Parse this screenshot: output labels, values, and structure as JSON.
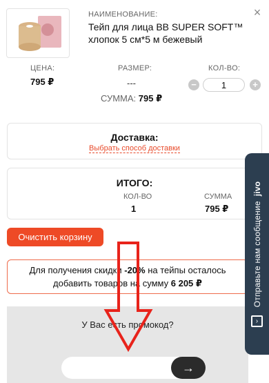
{
  "product": {
    "name_caption": "НАИМЕНОВАНИЕ:",
    "name": "Тейп для лица BB SUPER SOFT™ хлопок 5 см*5 м бежевый",
    "close_icon": "close-icon"
  },
  "columns": {
    "price_caption": "ЦЕНА:",
    "price_value": "795 ₽",
    "size_caption": "РАЗМЕР:",
    "size_value": "---",
    "qty_caption": "КОЛ-ВО:",
    "qty_value": "1",
    "minus_label": "−",
    "plus_label": "+",
    "sum_label": "СУММА:",
    "sum_value": "795 ₽"
  },
  "delivery": {
    "title": "Доставка:",
    "link": "Выбрать способ доставки"
  },
  "total": {
    "title": "ИТОГО:",
    "qty_caption": "КОЛ-ВО",
    "qty_value": "1",
    "sum_caption": "СУММА",
    "sum_value": "795 ₽"
  },
  "clear_button": "Очистить корзину",
  "discount": {
    "line1_pre": "Для получения скидки ",
    "line1_percent": "-20%",
    "line1_post": " на тейпы осталось",
    "line2_pre": "добавить товаров на сумму ",
    "line2_amount": "6 205 ₽"
  },
  "promo": {
    "caption": "У Вас есть промокод?",
    "input_value": "",
    "button_icon": "arrow-right-icon",
    "button_label": "→"
  },
  "chat_widget": {
    "label": "Отправьте нам сообщение",
    "brand": "jivo",
    "icon": "chat-icon"
  },
  "colors": {
    "accent": "#ee4a26",
    "widget": "#2c3e50",
    "arrow": "#e8231b"
  }
}
